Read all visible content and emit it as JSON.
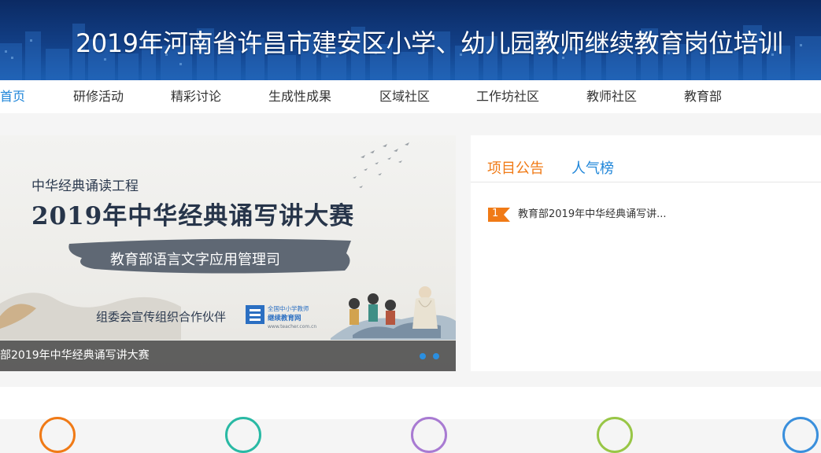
{
  "banner": {
    "title": "2019年河南省许昌市建安区小学、幼儿园教师继续教育岗位培训"
  },
  "nav": {
    "items": [
      {
        "label": "首页",
        "active": true
      },
      {
        "label": "研修活动"
      },
      {
        "label": "精彩讨论"
      },
      {
        "label": "生成性成果"
      },
      {
        "label": "区域社区"
      },
      {
        "label": "工作坊社区"
      },
      {
        "label": "教师社区"
      },
      {
        "label": "教育部"
      }
    ]
  },
  "slide": {
    "subtitle": "中华经典诵读工程",
    "title": "2019年中华经典诵写讲大赛",
    "organizer": "教育部语言文字应用管理司",
    "partner_label": "组委会宣传组织合作伙伴",
    "partner_logo_line1": "全国中小学教师",
    "partner_logo_line2": "继续教育网",
    "partner_logo_url": "www.teacher.com.cn",
    "caption": "部2019年中华经典诵写讲大赛"
  },
  "panel": {
    "tabs": [
      {
        "label": "项目公告",
        "active": true
      },
      {
        "label": "人气榜"
      }
    ],
    "notices": [
      {
        "rank": "1",
        "text": "教育部2019年中华经典诵写讲..."
      }
    ]
  },
  "colors": {
    "accent_blue": "#1f86d9",
    "accent_orange": "#f07a16",
    "banner_dark": "#0b2a63",
    "circle_colors": [
      "#f07a16",
      "#29b9a4",
      "#a87ad2",
      "#98c646",
      "#3a8fdc"
    ]
  }
}
